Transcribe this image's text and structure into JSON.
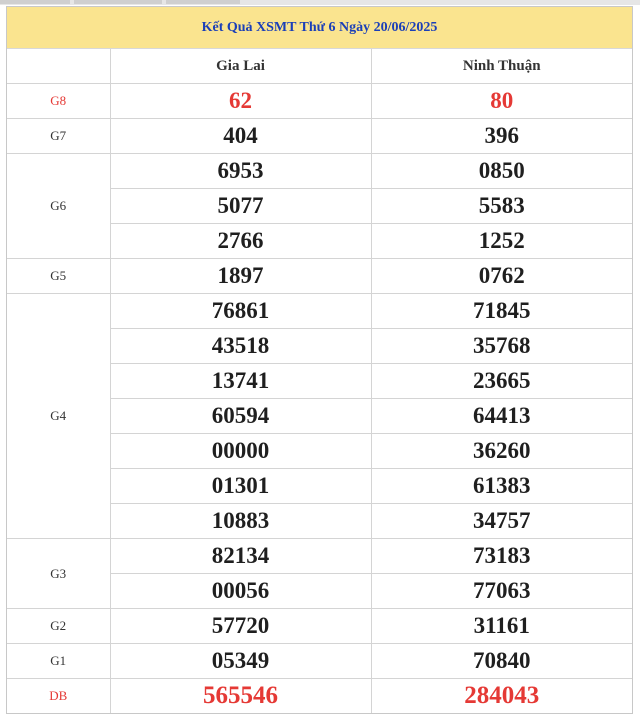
{
  "title": "Kết Quả XSMT Thứ 6 Ngày 20/06/2025",
  "provinces": [
    "Gia Lai",
    "Ninh Thuận"
  ],
  "prizes": [
    {
      "label": "G8",
      "highlight": true,
      "rows": [
        [
          "62",
          "80"
        ]
      ]
    },
    {
      "label": "G7",
      "highlight": false,
      "rows": [
        [
          "404",
          "396"
        ]
      ]
    },
    {
      "label": "G6",
      "highlight": false,
      "rows": [
        [
          "6953",
          "0850"
        ],
        [
          "5077",
          "5583"
        ],
        [
          "2766",
          "1252"
        ]
      ]
    },
    {
      "label": "G5",
      "highlight": false,
      "rows": [
        [
          "1897",
          "0762"
        ]
      ]
    },
    {
      "label": "G4",
      "highlight": false,
      "rows": [
        [
          "76861",
          "71845"
        ],
        [
          "43518",
          "35768"
        ],
        [
          "13741",
          "23665"
        ],
        [
          "60594",
          "64413"
        ],
        [
          "00000",
          "36260"
        ],
        [
          "01301",
          "61383"
        ],
        [
          "10883",
          "34757"
        ]
      ]
    },
    {
      "label": "G3",
      "highlight": false,
      "rows": [
        [
          "82134",
          "73183"
        ],
        [
          "00056",
          "77063"
        ]
      ]
    },
    {
      "label": "G2",
      "highlight": false,
      "rows": [
        [
          "57720",
          "31161"
        ]
      ]
    },
    {
      "label": "G1",
      "highlight": false,
      "rows": [
        [
          "05349",
          "70840"
        ]
      ]
    },
    {
      "label": "DB",
      "highlight": true,
      "rows": [
        [
          "565546",
          "284043"
        ]
      ]
    }
  ],
  "colors": {
    "title_bg": "#fae48f",
    "title_text": "#1b3fb8",
    "highlight": "#e53935"
  }
}
